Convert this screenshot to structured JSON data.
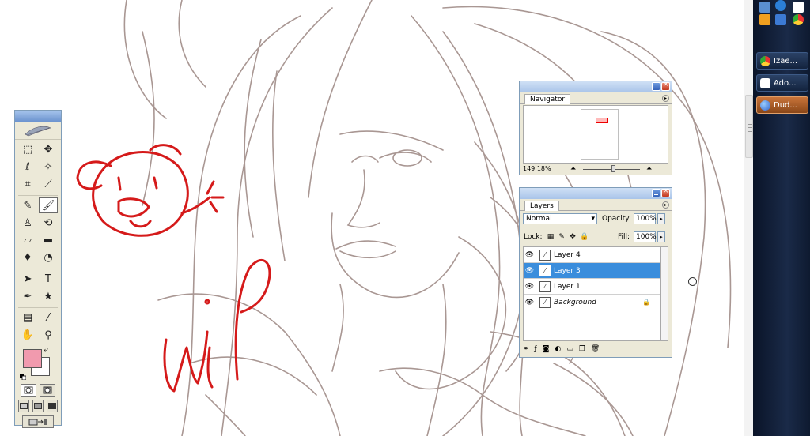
{
  "canvas": {
    "annotation_text": "WiP",
    "sketch_color": "#9b8783",
    "doodle_color": "#d51a1a"
  },
  "taskbar": {
    "tasks": [
      {
        "label": "Izae...",
        "icon": "chrome-icon",
        "active": false
      },
      {
        "label": "Ado...",
        "icon": "photoshop-icon",
        "active": false
      },
      {
        "label": "Dud...",
        "icon": "messenger-icon",
        "active": true
      }
    ],
    "tray_icons": [
      "network-icon",
      "ie-icon",
      "blank-icon",
      "media-icon",
      "desktop-icon",
      "chrome-icon"
    ]
  },
  "toolbox": {
    "foreground_color": "#f19aae",
    "background_color": "#ffffff",
    "tools": [
      [
        "marquee-icon",
        "move-icon"
      ],
      [
        "lasso-icon",
        "magic-wand-icon"
      ],
      [
        "crop-icon",
        "slice-icon"
      ],
      [
        "healing-icon",
        "brush-icon"
      ],
      [
        "stamp-icon",
        "history-brush-icon"
      ],
      [
        "eraser-icon",
        "gradient-icon"
      ],
      [
        "blur-icon",
        "dodge-icon"
      ],
      [
        "path-select-icon",
        "type-icon"
      ],
      [
        "pen-icon",
        "shape-icon"
      ],
      [
        "notes-icon",
        "eyedropper-icon"
      ],
      [
        "hand-icon",
        "zoom-icon"
      ]
    ],
    "selected_tool": "brush-icon"
  },
  "navigator": {
    "tab_label": "Navigator",
    "zoom": "149.18%"
  },
  "layers": {
    "tab_label": "Layers",
    "blend_mode": "Normal",
    "opacity_label": "Opacity:",
    "opacity_value": "100%",
    "lock_label": "Lock:",
    "fill_label": "Fill:",
    "fill_value": "100%",
    "items": [
      {
        "name": "Layer 4",
        "selected": false,
        "locked": false,
        "italic": false
      },
      {
        "name": "Layer 3",
        "selected": true,
        "locked": false,
        "italic": false
      },
      {
        "name": "Layer 1",
        "selected": false,
        "locked": false,
        "italic": false
      },
      {
        "name": "Background",
        "selected": false,
        "locked": true,
        "italic": true
      }
    ]
  }
}
